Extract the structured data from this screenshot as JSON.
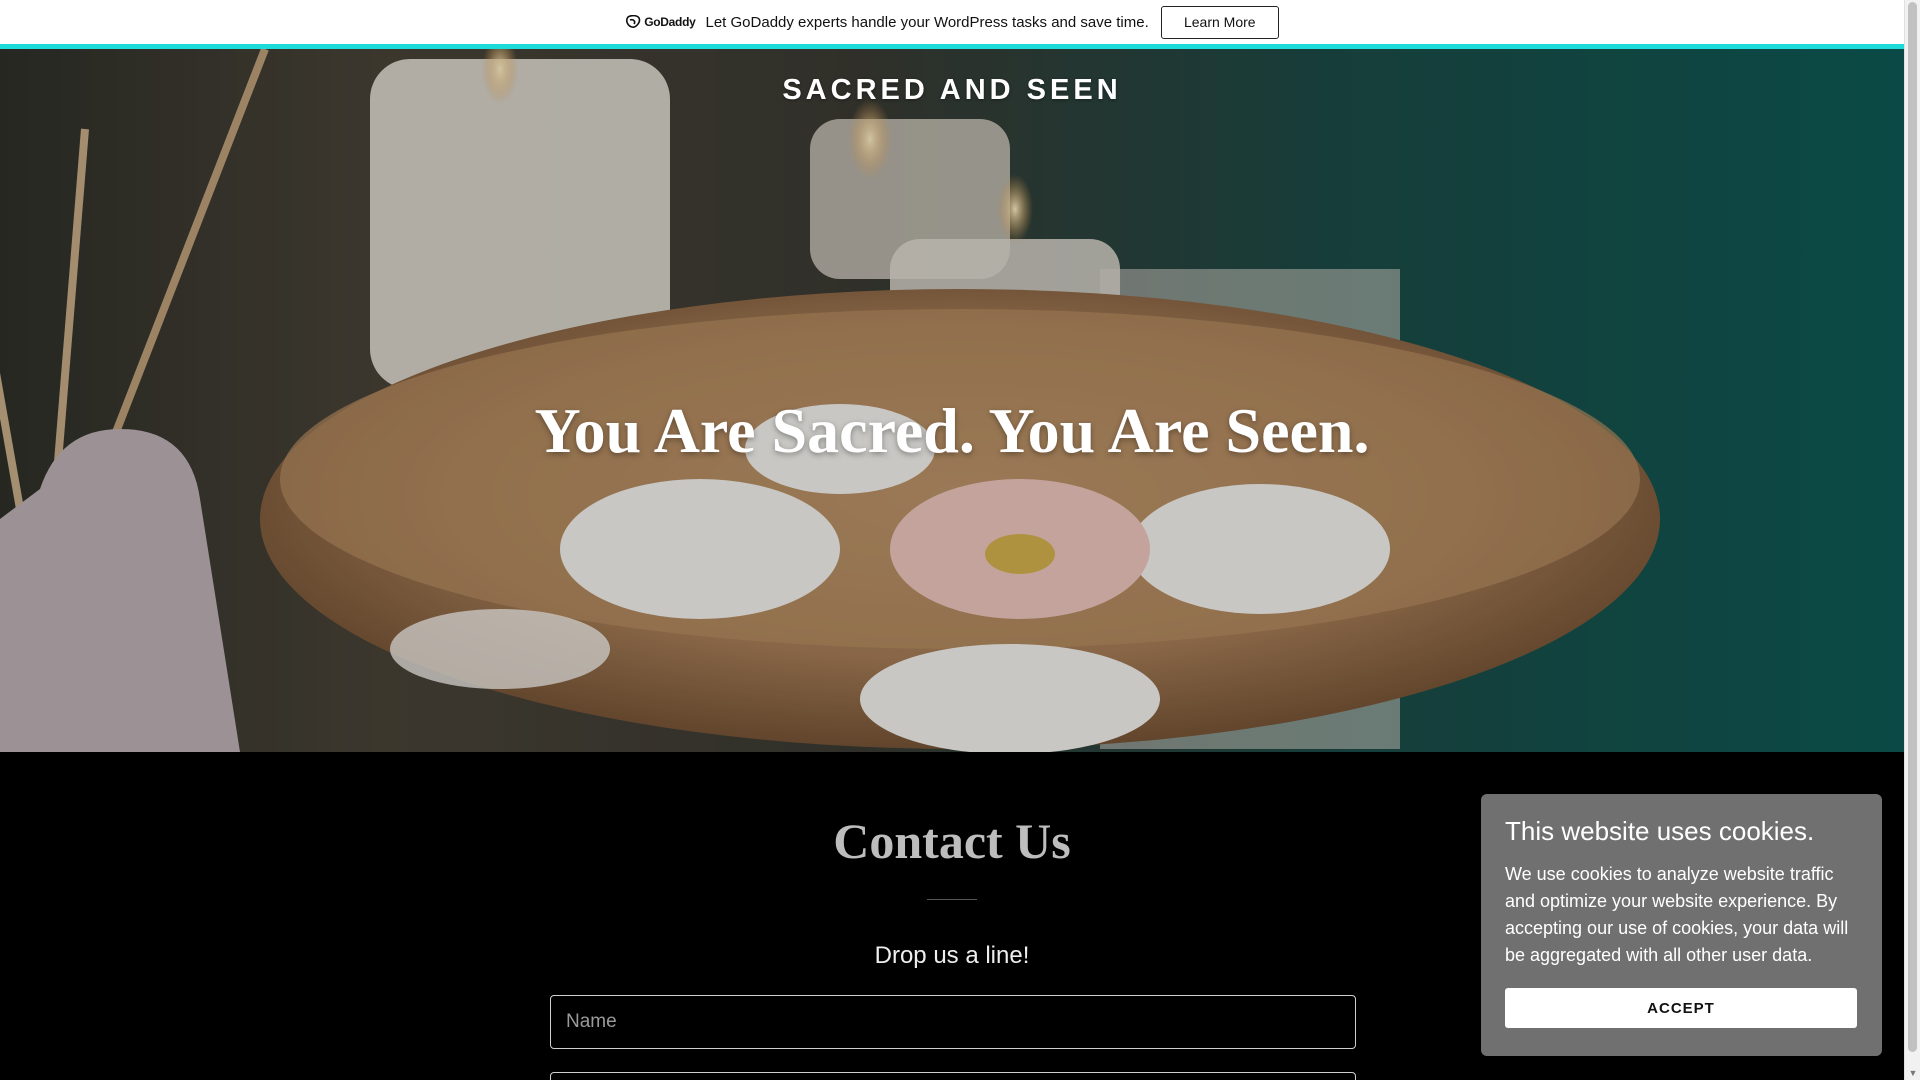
{
  "promo": {
    "brand": "GoDaddy",
    "message": "Let GoDaddy experts handle your WordPress tasks and save time.",
    "button_label": "Learn More"
  },
  "hero": {
    "site_title": "SACRED AND SEEN",
    "heading": "You Are Sacred. You Are Seen."
  },
  "contact": {
    "title": "Contact Us",
    "subtitle": "Drop us a line!",
    "name_placeholder": "Name"
  },
  "cookie": {
    "title": "This website uses cookies.",
    "text": "We use cookies to analyze website traffic and optimize your website experience. By accepting our use of cookies, your data will be aggregated with all other user data.",
    "accept_label": "ACCEPT"
  },
  "colors": {
    "accent": "#1bdbdb",
    "contact_bg": "#000000",
    "cookie_bg": "#707070"
  }
}
